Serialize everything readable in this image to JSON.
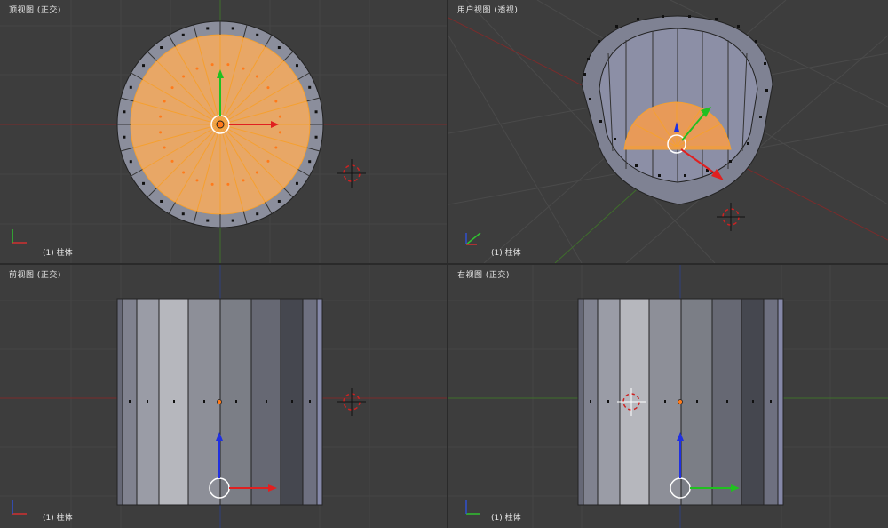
{
  "viewports": {
    "top": {
      "title": "顶视图 (正交)",
      "object_label": "(1) 柱体"
    },
    "user": {
      "title": "用户视图 (透视)",
      "object_label": "(1) 柱体"
    },
    "front": {
      "title": "前视图 (正交)",
      "object_label": "(1) 柱体"
    },
    "right": {
      "title": "右视图 (正交)",
      "object_label": "(1) 柱体"
    }
  },
  "colors": {
    "background": "#3d3d3d",
    "grid": "#4a4a4a",
    "x_axis": "#8c2a2a",
    "y_axis": "#4c8c2a",
    "z_axis": "#2a4c8c",
    "mesh_face": "#8b8e9c",
    "selected_face": "#e89a58",
    "selected_edge": "#f5a030",
    "vertex": "#000000",
    "selected_vertex": "#ff7a1a",
    "gizmo_x": "#e02020",
    "gizmo_y": "#20c020",
    "gizmo_z": "#2030e0"
  },
  "icons": [
    "3d-cursor-icon",
    "axis-gizmo-icon",
    "manipulator-icon"
  ]
}
